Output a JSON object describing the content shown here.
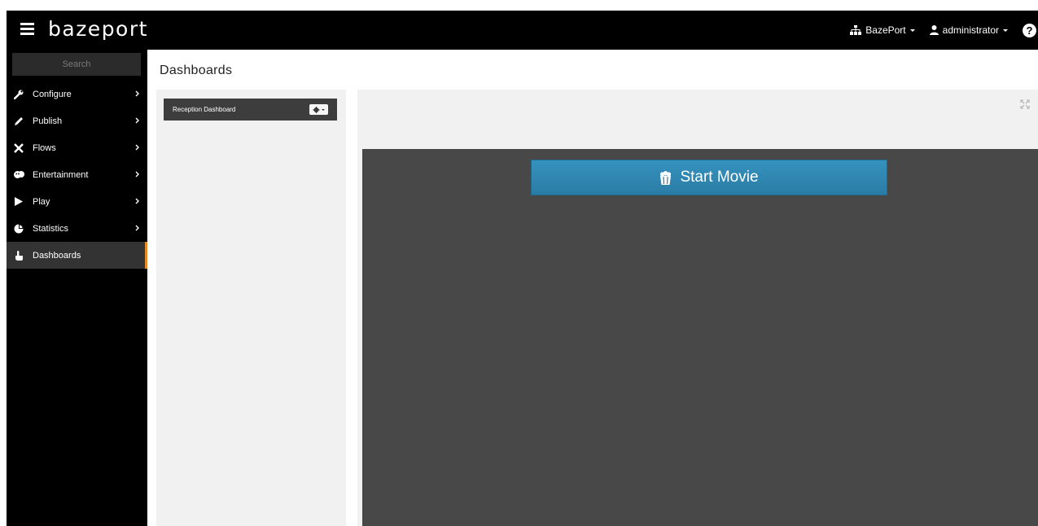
{
  "app": {
    "brand": "bazeport"
  },
  "navbar": {
    "org_label": "BazePort",
    "user_label": "administrator",
    "help_label": "?"
  },
  "sidebar": {
    "search_placeholder": "Search",
    "items": [
      {
        "label": "Configure",
        "icon": "wrench-icon",
        "has_submenu": true
      },
      {
        "label": "Publish",
        "icon": "pencil-icon",
        "has_submenu": true
      },
      {
        "label": "Flows",
        "icon": "flows-icon",
        "has_submenu": true
      },
      {
        "label": "Entertainment",
        "icon": "entertainment-icon",
        "has_submenu": true
      },
      {
        "label": "Play",
        "icon": "play-icon",
        "has_submenu": true
      },
      {
        "label": "Statistics",
        "icon": "pie-chart-icon",
        "has_submenu": true
      },
      {
        "label": "Dashboards",
        "icon": "hand-pointer-icon",
        "has_submenu": false,
        "active": true
      }
    ]
  },
  "main": {
    "title": "Dashboards",
    "dashboards": [
      {
        "label": "Reception Dashboard"
      }
    ],
    "widget": {
      "button_label": "Start Movie",
      "button_icon": "popcorn-icon"
    }
  },
  "colors": {
    "navbar_bg": "#000000",
    "sidebar_bg": "#000000",
    "active_indicator": "#e58a2a",
    "canvas_bg": "#484848",
    "button_bg": "#2a7ca5"
  }
}
